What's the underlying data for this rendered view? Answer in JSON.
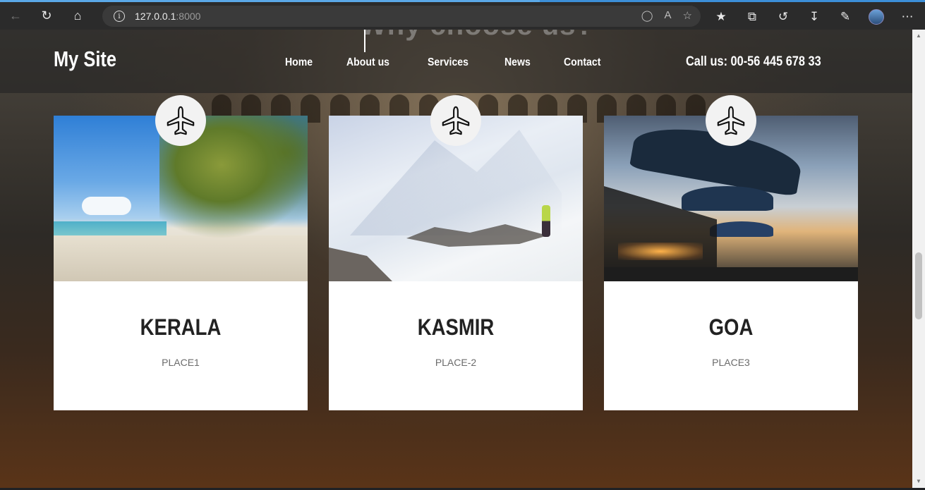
{
  "browser": {
    "url_host": "127.0.0.1",
    "url_port": ":8000",
    "info_glyph": "i",
    "icons": [
      "back-icon",
      "reload-icon",
      "home-icon",
      "info-icon",
      "tag-icon",
      "read-aloud-icon",
      "add-favorite-icon",
      "favorites-icon",
      "collections-icon",
      "history-icon",
      "downloads-icon",
      "extensions-icon",
      "profile-avatar",
      "more-icon"
    ]
  },
  "site": {
    "ghost_heading": "Why choose us?",
    "logo": "My Site",
    "nav": [
      {
        "label": "Home"
      },
      {
        "label": "About us"
      },
      {
        "label": "Services"
      },
      {
        "label": "News"
      },
      {
        "label": "Contact"
      }
    ],
    "call": "Call us: 00-56 445 678 33"
  },
  "cards": [
    {
      "title": "KERALA",
      "subtitle": "PLACE1",
      "photo": "palm-beach",
      "icon": "airplane-icon"
    },
    {
      "title": "KASMIR",
      "subtitle": "PLACE-2",
      "photo": "snowy-mountain",
      "icon": "airplane-icon"
    },
    {
      "title": "GOA",
      "subtitle": "PLACE3",
      "photo": "beach-umbrellas",
      "icon": "airplane-icon"
    }
  ],
  "colors": {
    "header_overlay": "#232323",
    "card_bg": "#ffffff",
    "title": "#222222",
    "subtitle": "#6b6b6b",
    "accent_browser": "#3c8fd8"
  }
}
